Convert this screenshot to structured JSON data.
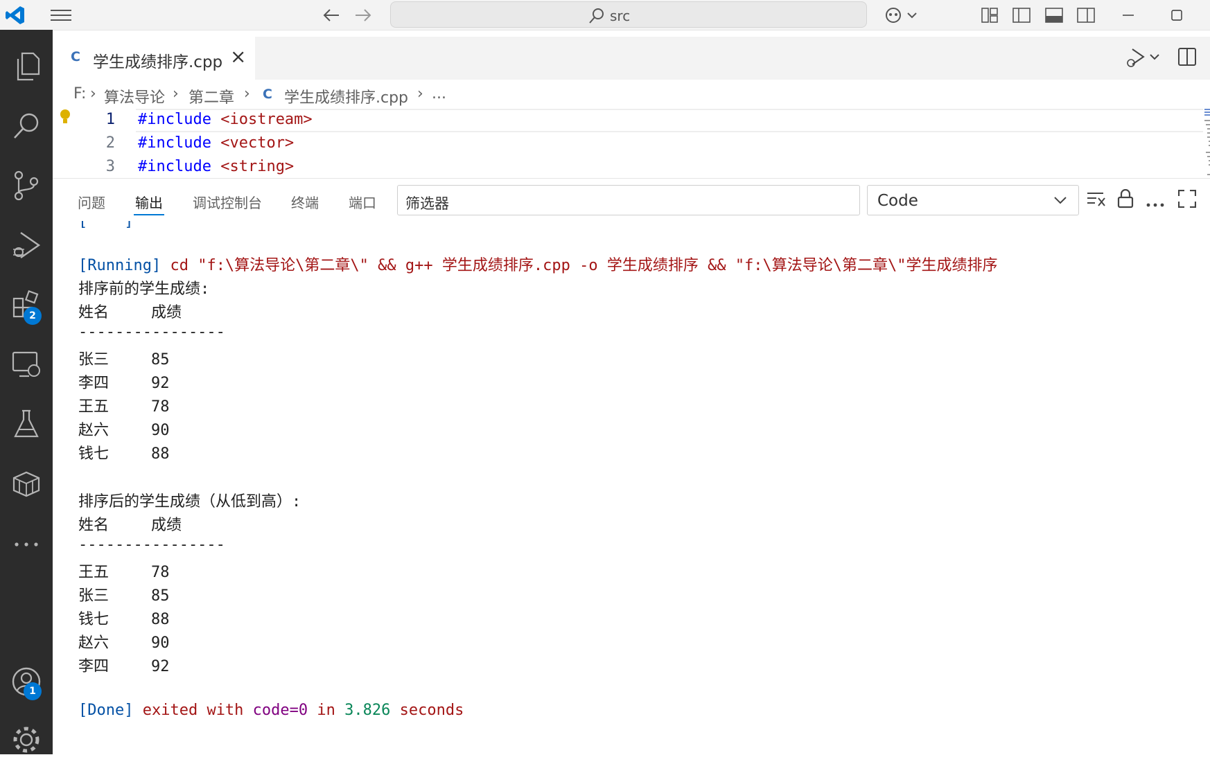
{
  "titlebar": {
    "search_text": "src"
  },
  "activity": {
    "extensions_badge": "2",
    "accounts_badge": "1"
  },
  "tab": {
    "label": "学生成绩排序.cpp",
    "icon_glyph": "C"
  },
  "breadcrumb": {
    "drive": "F:",
    "folder1": "算法导论",
    "folder2": "第二章",
    "file": "学生成绩排序.cpp",
    "more": "..."
  },
  "editor": {
    "lines": [
      {
        "num": "1",
        "kw": "#include",
        "inc": "<iostream>"
      },
      {
        "num": "2",
        "kw": "#include",
        "inc": "<vector>"
      },
      {
        "num": "3",
        "kw": "#include",
        "inc": "<string>"
      }
    ]
  },
  "panel": {
    "tabs": [
      "问题",
      "输出",
      "调试控制台",
      "终端",
      "端口"
    ],
    "filter_placeholder": "筛选器",
    "channel": "Code"
  },
  "output": {
    "running_tag": "[Running]",
    "running_cmd": " cd \"f:\\算法导论\\第二章\\\" && g++ 学生成绩排序.cpp -o 学生成绩排序 && \"f:\\算法导论\\第二章\\\"学生成绩排序",
    "before_title": "排序前的学生成绩:",
    "header_name": "姓名",
    "header_score": "成绩",
    "separator": "----------------",
    "before_rows": [
      {
        "name": "张三",
        "score": "85"
      },
      {
        "name": "李四",
        "score": "92"
      },
      {
        "name": "王五",
        "score": "78"
      },
      {
        "name": "赵六",
        "score": "90"
      },
      {
        "name": "钱七",
        "score": "88"
      }
    ],
    "after_title": "排序后的学生成绩（从低到高）:",
    "after_rows": [
      {
        "name": "王五",
        "score": "78"
      },
      {
        "name": "张三",
        "score": "85"
      },
      {
        "name": "钱七",
        "score": "88"
      },
      {
        "name": "赵六",
        "score": "90"
      },
      {
        "name": "李四",
        "score": "92"
      }
    ],
    "done_tag": "[Done]",
    "done_exited": " exited with ",
    "done_code": "code=0",
    "done_in": " in ",
    "done_time": "3.826",
    "done_seconds": " seconds"
  }
}
